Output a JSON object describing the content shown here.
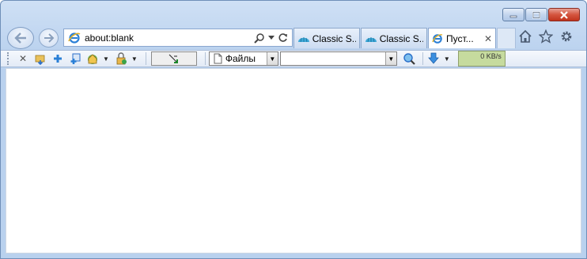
{
  "window": {
    "caption_buttons": {
      "minimize": "minimize-icon",
      "maximize": "maximize-icon",
      "close": "close-icon"
    }
  },
  "address_bar": {
    "url": "about:blank"
  },
  "tabs": [
    {
      "label": "Classic S...",
      "active": false
    },
    {
      "label": "Classic S...",
      "active": false
    },
    {
      "label": "Пуст...",
      "active": true,
      "close": "✕"
    }
  ],
  "toolbar": {
    "stop_glyph": "✕",
    "category_select": "Файлы",
    "search_select": "",
    "speed": "0 KB/s"
  },
  "colors": {
    "frame": "#bcd3ef",
    "speed_box": "#c6db9e",
    "close_button": "#d4553f"
  }
}
